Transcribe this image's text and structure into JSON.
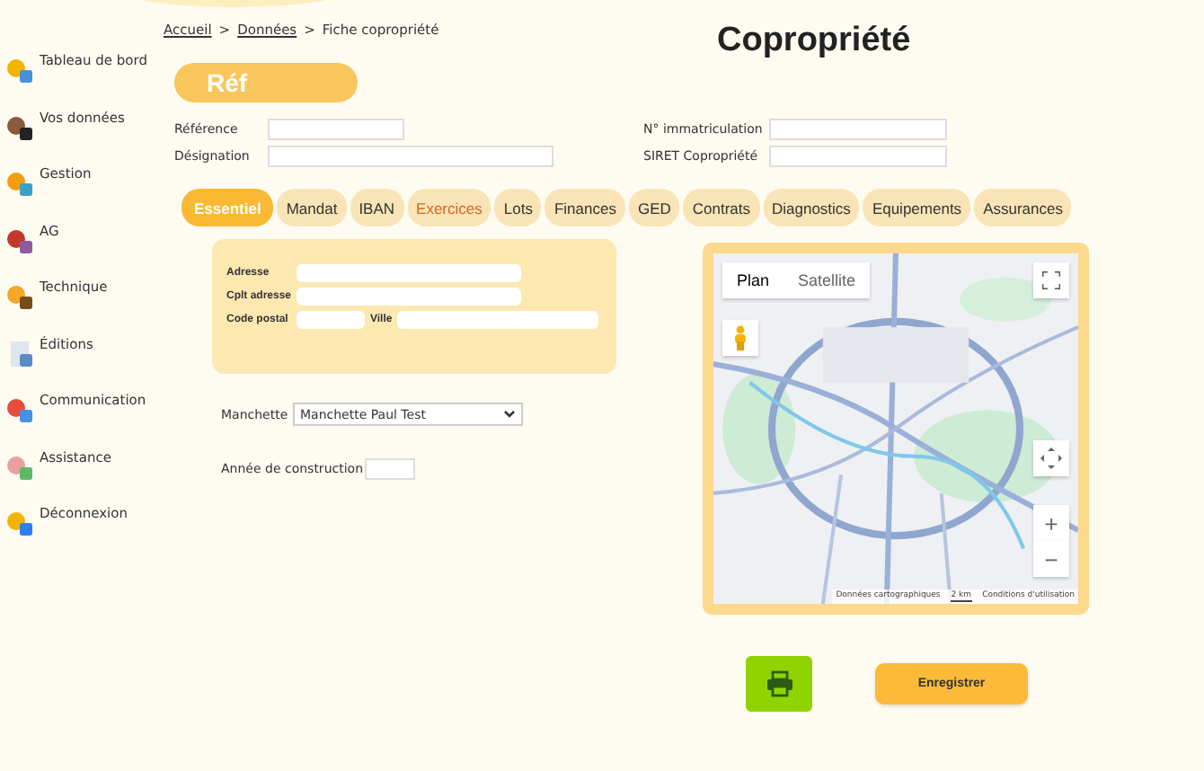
{
  "sidebar": {
    "items": [
      {
        "label": "Tableau de bord",
        "kind": "dashboard"
      },
      {
        "label": "Vos données",
        "kind": "person"
      },
      {
        "label": "Gestion",
        "kind": "calculator"
      },
      {
        "label": "AG",
        "kind": "meeting"
      },
      {
        "label": "Technique",
        "kind": "works"
      },
      {
        "label": "Éditions",
        "kind": "document"
      },
      {
        "label": "Communication",
        "kind": "chat"
      },
      {
        "label": "Assistance",
        "kind": "support"
      },
      {
        "label": "Déconnexion",
        "kind": "logout"
      }
    ]
  },
  "breadcrumb": {
    "separator": ">",
    "items": [
      {
        "label": "Accueil",
        "link": true
      },
      {
        "label": "Données",
        "link": true
      },
      {
        "label": "Fiche copropriété",
        "link": false
      }
    ]
  },
  "title": "Copropriété",
  "ref_banner": "Réf",
  "ref_fields": [
    {
      "label": "Référence",
      "wide": false
    },
    {
      "label": "N° immatriculation",
      "wide": true
    },
    {
      "label": "Désignation",
      "wide": true
    },
    {
      "label": "SIRET Copropriété",
      "wide": true
    }
  ],
  "tabs": [
    {
      "label": "Essentiel",
      "selected": true,
      "highlighted": false
    },
    {
      "label": "Mandat",
      "selected": false,
      "highlighted": false
    },
    {
      "label": "IBAN",
      "selected": false,
      "highlighted": false
    },
    {
      "label": "Exercices",
      "selected": false,
      "highlighted": true
    },
    {
      "label": "Lots",
      "selected": false,
      "highlighted": false
    },
    {
      "label": "Finances",
      "selected": false,
      "highlighted": false
    },
    {
      "label": "GED",
      "selected": false,
      "highlighted": false
    },
    {
      "label": "Contrats",
      "selected": false,
      "highlighted": false
    },
    {
      "label": "Diagnostics",
      "selected": false,
      "highlighted": false
    },
    {
      "label": "Equipements",
      "selected": false,
      "highlighted": false
    },
    {
      "label": "Assurances",
      "selected": false,
      "highlighted": false
    }
  ],
  "address": {
    "street_label": "Adresse",
    "extra_label": "Cplt adresse",
    "postcode_label": "Code postal",
    "city_label": "Ville"
  },
  "manchette": {
    "label": "Manchette",
    "value": "Manchette Paul Test"
  },
  "construction_year": {
    "label": "Année de construction"
  },
  "map": {
    "kind": "picture",
    "types": [
      {
        "label": "Plan",
        "selected": true
      },
      {
        "label": "Satellite",
        "selected": false
      }
    ],
    "zoom_in": "+",
    "zoom_out": "−",
    "attribution": "Données cartographiques",
    "scale": "2 km",
    "terms": "Conditions d'utilisation"
  },
  "save_button": "Enregistrer"
}
